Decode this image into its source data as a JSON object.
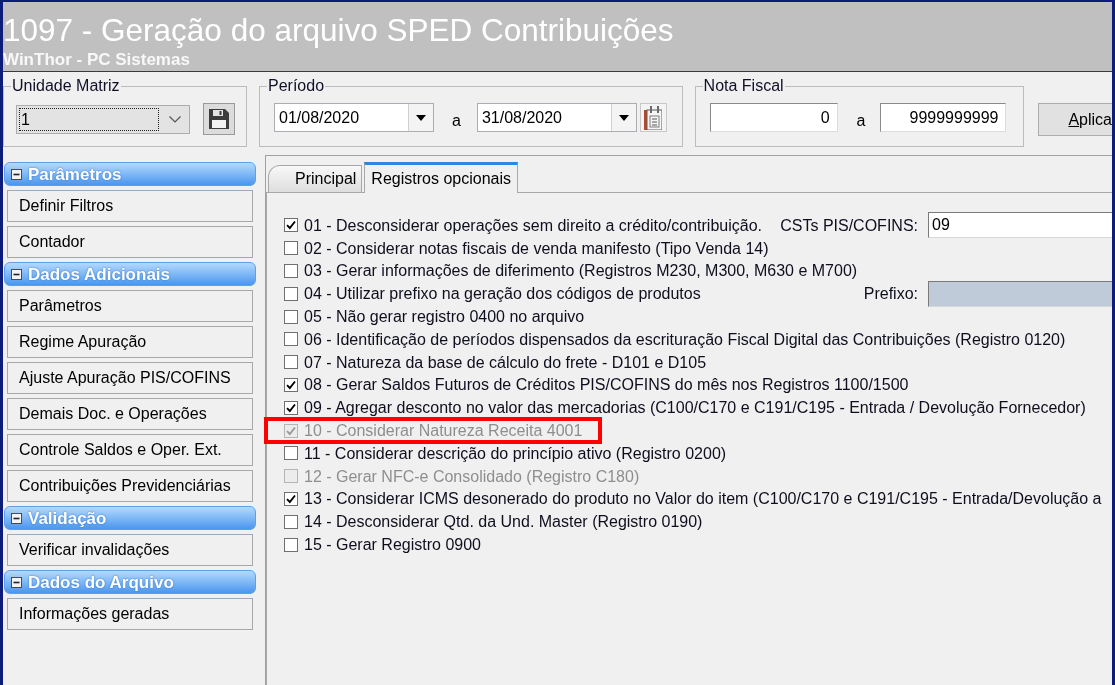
{
  "window": {
    "title": "1097 - Geração do arquivo SPED Contribuições",
    "subtitle": "WinThor - PC Sistemas"
  },
  "filters": {
    "unit": {
      "label": "Unidade Matriz",
      "value": "1"
    },
    "period": {
      "label": "Período",
      "from": "01/08/2020",
      "separator": "a",
      "to": "31/08/2020"
    },
    "invoice": {
      "label": "Nota Fiscal",
      "from": "0",
      "separator": "a",
      "to": "9999999999"
    },
    "apply_button": "Aplica"
  },
  "sidebar": {
    "sections": [
      {
        "title": "Parâmetros",
        "expanded": true,
        "items": [
          "Definir Filtros",
          "Contador"
        ]
      },
      {
        "title": "Dados Adicionais",
        "expanded": true,
        "items": [
          "Parâmetros",
          "Regime Apuração",
          "Ajuste Apuração PIS/COFINS",
          "Demais Doc. e Operações",
          "Controle Saldos e Oper. Ext.",
          "Contribuições Previdenciárias"
        ]
      },
      {
        "title": "Validação",
        "expanded": true,
        "items": [
          "Verificar invalidações"
        ]
      },
      {
        "title": "Dados do Arquivo",
        "expanded": true,
        "items": [
          "Informações geradas"
        ]
      }
    ]
  },
  "tabs": [
    {
      "label": "Principal",
      "selected": false
    },
    {
      "label": "Registros opcionais",
      "selected": true
    }
  ],
  "options": [
    {
      "label": "01 - Desconsiderar operações sem direito a crédito/contribuição.",
      "checked": true,
      "disabled": false,
      "highlighted": false,
      "field": {
        "label": "CSTs PIS/COFINS:",
        "value": "09",
        "disabled": false
      }
    },
    {
      "label": "02 - Considerar notas fiscais de venda manifesto (Tipo Venda 14)",
      "checked": false,
      "disabled": false,
      "highlighted": false
    },
    {
      "label": "03 - Gerar informações de diferimento (Registros M230, M300, M630 e M700)",
      "checked": false,
      "disabled": false,
      "highlighted": false
    },
    {
      "label": "04 - Utilizar prefixo na geração dos códigos de produtos",
      "checked": false,
      "disabled": false,
      "highlighted": false,
      "field": {
        "label": "Prefixo:",
        "disabled": true
      }
    },
    {
      "label": "05 - Não gerar registro 0400 no arquivo",
      "checked": false,
      "disabled": false,
      "highlighted": false
    },
    {
      "label": "06 - Identificação de períodos dispensados da escrituração Fiscal Digital das Contribuições (Registro 0120)",
      "checked": false,
      "disabled": false,
      "highlighted": false
    },
    {
      "label": "07 - Natureza da base de cálculo do frete - D101 e D105",
      "checked": false,
      "disabled": false,
      "highlighted": false
    },
    {
      "label": "08 - Gerar Saldos Futuros de Créditos PIS/COFINS do mês nos Registros 1100/1500",
      "checked": true,
      "disabled": false,
      "highlighted": false
    },
    {
      "label": "09 - Agregar desconto no valor das mercadorias (C100/C170 e C191/C195 - Entrada / Devolução Fornecedor)",
      "checked": true,
      "disabled": false,
      "highlighted": false
    },
    {
      "label": "10 - Considerar Natureza Receita 4001",
      "checked": true,
      "disabled": true,
      "highlighted": true
    },
    {
      "label": "11 - Considerar descrição do princípio ativo (Registro 0200)",
      "checked": false,
      "disabled": false,
      "highlighted": false
    },
    {
      "label": "12 - Gerar NFC-e Consolidado (Registro C180)",
      "checked": false,
      "disabled": true,
      "highlighted": false
    },
    {
      "label": "13 - Considerar ICMS desonerado do produto no Valor do item (C100/C170 e C191/C195 - Entrada/Devolução a",
      "checked": true,
      "disabled": false,
      "highlighted": false
    },
    {
      "label": "14 - Desconsiderar Qtd. da Und. Master (Registro 0190)",
      "checked": false,
      "disabled": false,
      "highlighted": false
    },
    {
      "label": "15 - Gerar Registro 0900",
      "checked": false,
      "disabled": false,
      "highlighted": false
    }
  ]
}
